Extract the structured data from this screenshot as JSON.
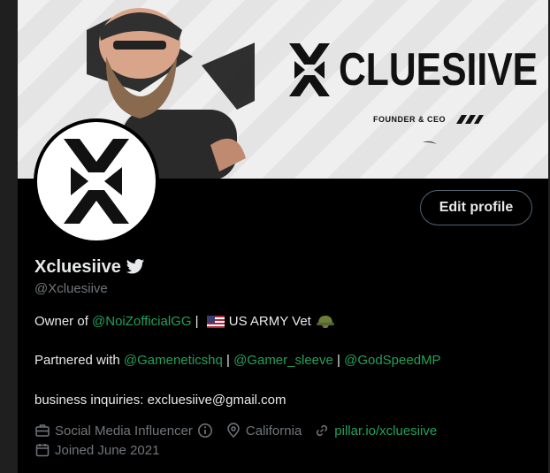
{
  "banner": {
    "title": "CLUESIIVE",
    "subtitle": "FOUNDER & CEO"
  },
  "profile": {
    "edit_button": "Edit profile",
    "display_name": "Xcluesiive",
    "handle": "@Xcluesiive"
  },
  "bio": {
    "line1": {
      "prefix": "Owner of ",
      "mention": "@NoiZofficialGG",
      "sep": " | ",
      "after_flag": "US ARMY Vet"
    },
    "line2": {
      "prefix": "Partnered with ",
      "mention1": "@Gameneticshq",
      "sep1": " | ",
      "mention2": "@Gamer_sleeve",
      "sep2": " | ",
      "mention3": "@GodSpeedMP"
    },
    "line3": "business inquiries: excluesiive@gmail.com"
  },
  "meta": {
    "category": "Social Media Influencer",
    "location": "California",
    "website": "pillar.io/xcluesiive",
    "joined": "Joined June 2021"
  },
  "icons": {
    "verified": "twitter-bird-icon",
    "category": "briefcase-icon",
    "info": "info-icon",
    "location": "location-pin-icon",
    "link": "link-icon",
    "calendar": "calendar-icon",
    "flag": "us-flag-icon",
    "helmet": "military-helmet-icon"
  },
  "colors": {
    "background": "#000000",
    "text": "#e7e9ea",
    "secondary_text": "#71767b",
    "accent": "#22a05b",
    "button_border": "#536471"
  }
}
